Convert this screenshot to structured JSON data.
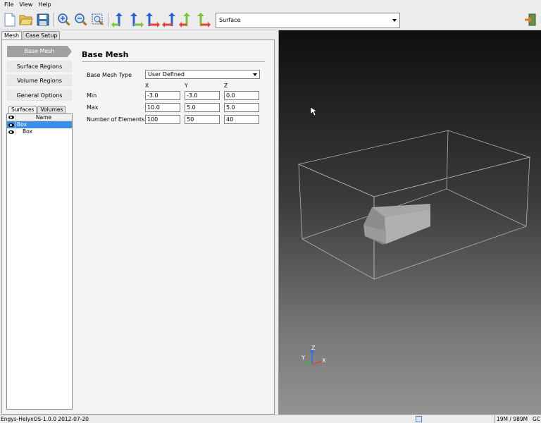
{
  "menubar": {
    "items": [
      "File",
      "View",
      "Help"
    ]
  },
  "toolbar": {
    "icons": [
      "new-file-icon",
      "open-folder-icon",
      "save-icon",
      "zoom-in-icon",
      "zoom-out-icon",
      "zoom-fit-icon",
      "view-xy-icon",
      "view-yx-icon",
      "view-xz-icon",
      "view-zx-icon",
      "view-yz-icon",
      "view-zy-icon",
      "exit-icon"
    ],
    "display_mode": "Surface"
  },
  "main_tabs": [
    "Mesh",
    "Case Setup"
  ],
  "nav": {
    "items": [
      "Base Mesh",
      "Surface Regions",
      "Volume Regions",
      "General Options"
    ]
  },
  "sub_tabs": [
    "Surfaces",
    "Volumes"
  ],
  "tree": {
    "header": "Name",
    "rows": [
      "Box",
      "Box"
    ]
  },
  "form": {
    "title": "Base Mesh",
    "base_mesh_type_label": "Base Mesh Type",
    "base_mesh_type": "User Defined",
    "columns": [
      "X",
      "Y",
      "Z"
    ],
    "rows": [
      {
        "label": "Min",
        "values": [
          "-3.0",
          "-3.0",
          "0.0"
        ]
      },
      {
        "label": "Max",
        "values": [
          "10.0",
          "5.0",
          "5.0"
        ]
      },
      {
        "label": "Number of Elements",
        "values": [
          "100",
          "50",
          "40"
        ]
      }
    ]
  },
  "viewport": {
    "axes": [
      "Z",
      "Y",
      "X"
    ]
  },
  "status": {
    "text": "Engys-HelyxOS-1.0.0 2012-07-20",
    "memory": "19M / 989M",
    "gc": "GC"
  },
  "colors": {
    "selection": "#3c8ee6",
    "nav_active": "#a0a0a0"
  }
}
